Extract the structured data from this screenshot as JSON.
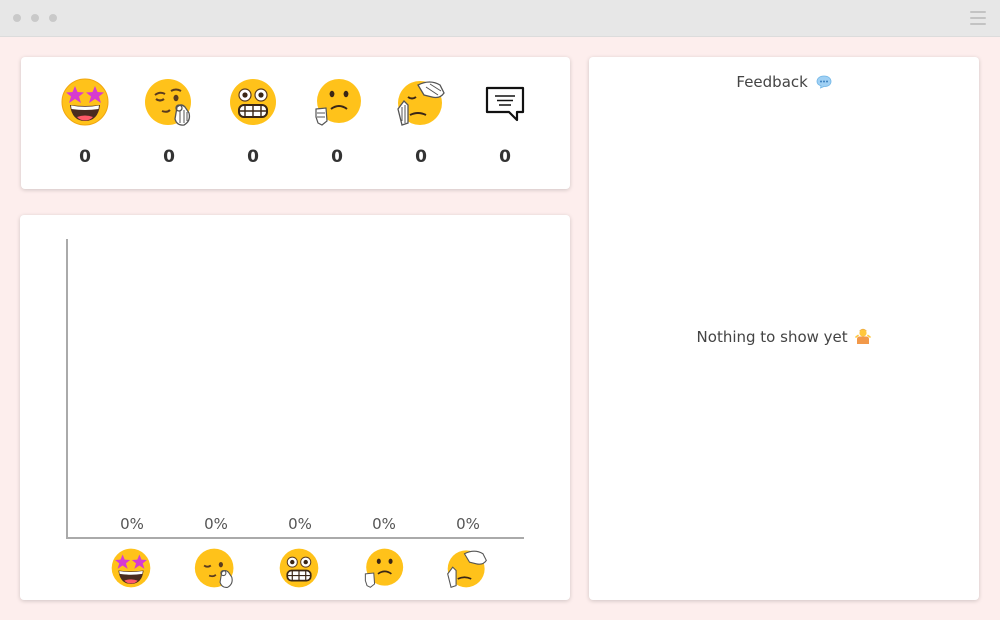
{
  "reactions": [
    {
      "icon": "star-struck-emoji-icon",
      "count": "0"
    },
    {
      "icon": "winking-ok-emoji-icon",
      "count": "0"
    },
    {
      "icon": "grimacing-emoji-icon",
      "count": "0"
    },
    {
      "icon": "sad-thumbs-down-emoji-icon",
      "count": "0"
    },
    {
      "icon": "facepalm-emoji-icon",
      "count": "0"
    },
    {
      "icon": "speech-bubble-icon",
      "count": "0"
    }
  ],
  "chart_data": {
    "type": "bar",
    "categories": [
      "star-struck",
      "winking",
      "grimacing",
      "sad",
      "facepalm"
    ],
    "values": [
      0,
      0,
      0,
      0,
      0
    ],
    "labels": [
      "0%",
      "0%",
      "0%",
      "0%",
      "0%"
    ],
    "ylim": [
      0,
      100
    ],
    "grid": false
  },
  "feedback": {
    "title": "Feedback",
    "title_icon": "speech-balloon-icon",
    "empty_text": "Nothing to show yet",
    "empty_icon": "person-shrugging-icon"
  },
  "colors": {
    "background": "#fdeeed",
    "face": "#ffc21a",
    "star": "#d63bd1"
  }
}
